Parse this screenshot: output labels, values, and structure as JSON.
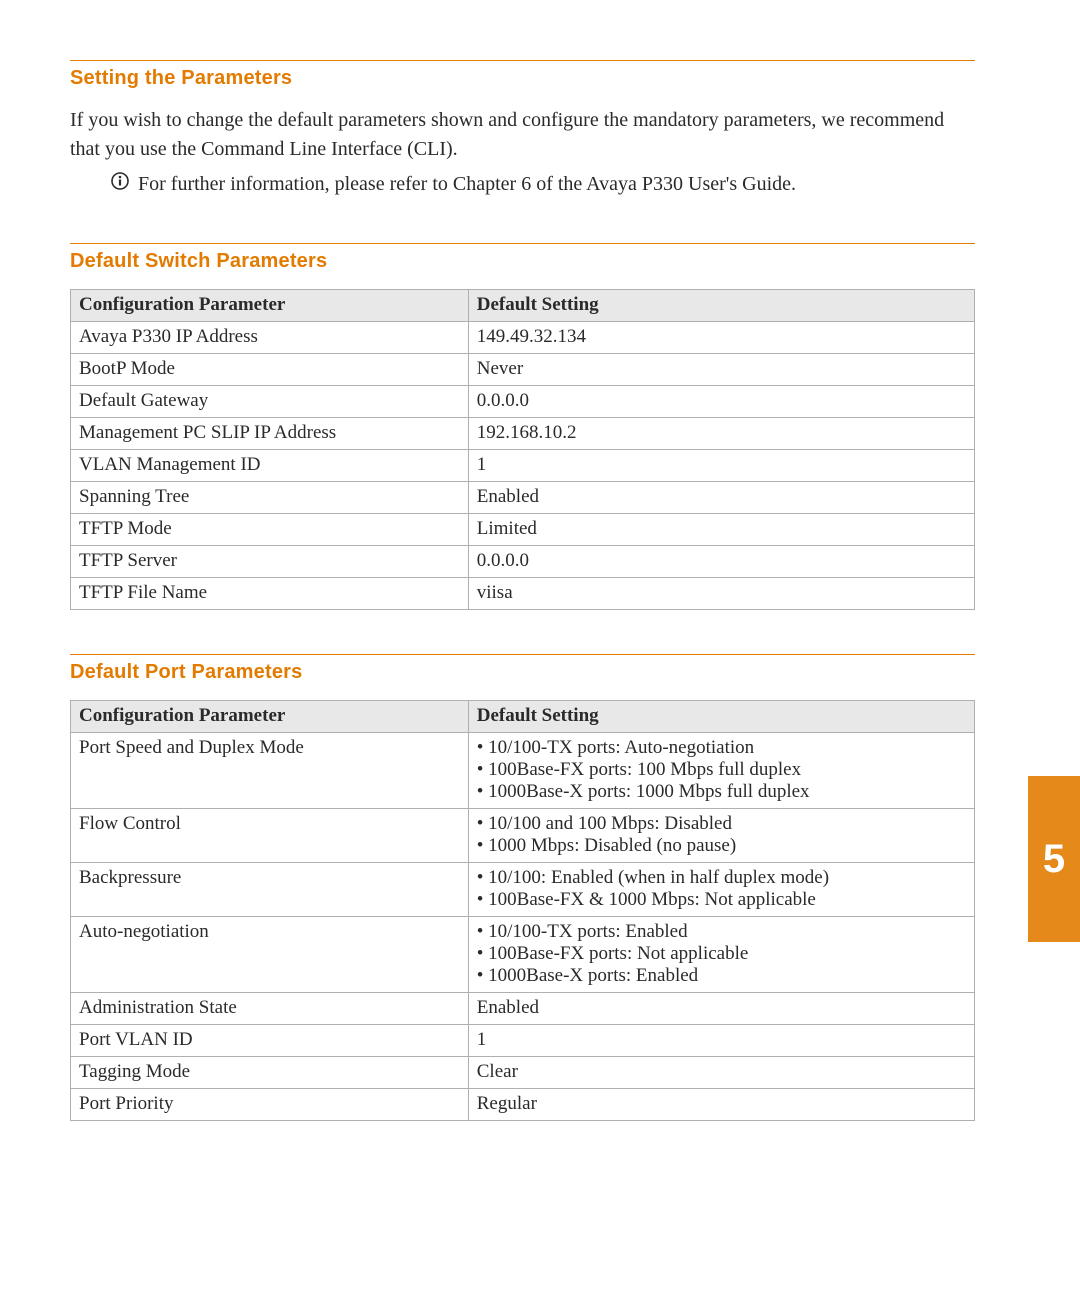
{
  "sections": {
    "setting": {
      "heading": "Setting the Parameters",
      "p1": "If you wish to change the default parameters shown and configure the mandatory parameters, we recommend that you use the Command Line Interface (CLI).",
      "note": "For further information, please refer to Chapter 6 of the Avaya P330 User's Guide."
    },
    "switch": {
      "heading": "Default Switch Parameters",
      "col1": "Configuration Parameter",
      "col2": "Default Setting",
      "rows": [
        {
          "param": "Avaya P330 IP Address",
          "setting": "149.49.32.134"
        },
        {
          "param": "BootP Mode",
          "setting": "Never"
        },
        {
          "param": "Default Gateway",
          "setting": "0.0.0.0"
        },
        {
          "param": "Management PC SLIP IP Address",
          "setting": "192.168.10.2"
        },
        {
          "param": "VLAN Management ID",
          "setting": "1"
        },
        {
          "param": "Spanning Tree",
          "setting": "Enabled"
        },
        {
          "param": "TFTP Mode",
          "setting": "Limited"
        },
        {
          "param": "TFTP Server",
          "setting": "0.0.0.0"
        },
        {
          "param": "TFTP File Name",
          "setting": "viisa"
        }
      ]
    },
    "port": {
      "heading": "Default Port Parameters",
      "col1": "Configuration Parameter",
      "col2": "Default Setting",
      "rows": [
        {
          "param": "Port Speed and Duplex Mode",
          "list": [
            "10/100-TX ports: Auto-negotiation",
            "100Base-FX ports: 100 Mbps full duplex",
            "1000Base-X ports: 1000 Mbps full duplex"
          ]
        },
        {
          "param": "Flow Control",
          "list": [
            "10/100 and 100 Mbps: Disabled",
            "1000 Mbps: Disabled (no pause)"
          ]
        },
        {
          "param": "Backpressure",
          "list": [
            "10/100: Enabled (when in half duplex mode)",
            "100Base-FX & 1000 Mbps: Not applicable"
          ]
        },
        {
          "param": "Auto-negotiation",
          "list": [
            "10/100-TX ports: Enabled",
            "100Base-FX ports: Not applicable",
            "1000Base-X ports: Enabled"
          ]
        },
        {
          "param": "Administration State",
          "setting": "Enabled"
        },
        {
          "param": "Port VLAN ID",
          "setting": "1"
        },
        {
          "param": "Tagging Mode",
          "setting": "Clear"
        },
        {
          "param": "Port Priority",
          "setting": "Regular"
        }
      ]
    }
  },
  "page_tab": "5"
}
